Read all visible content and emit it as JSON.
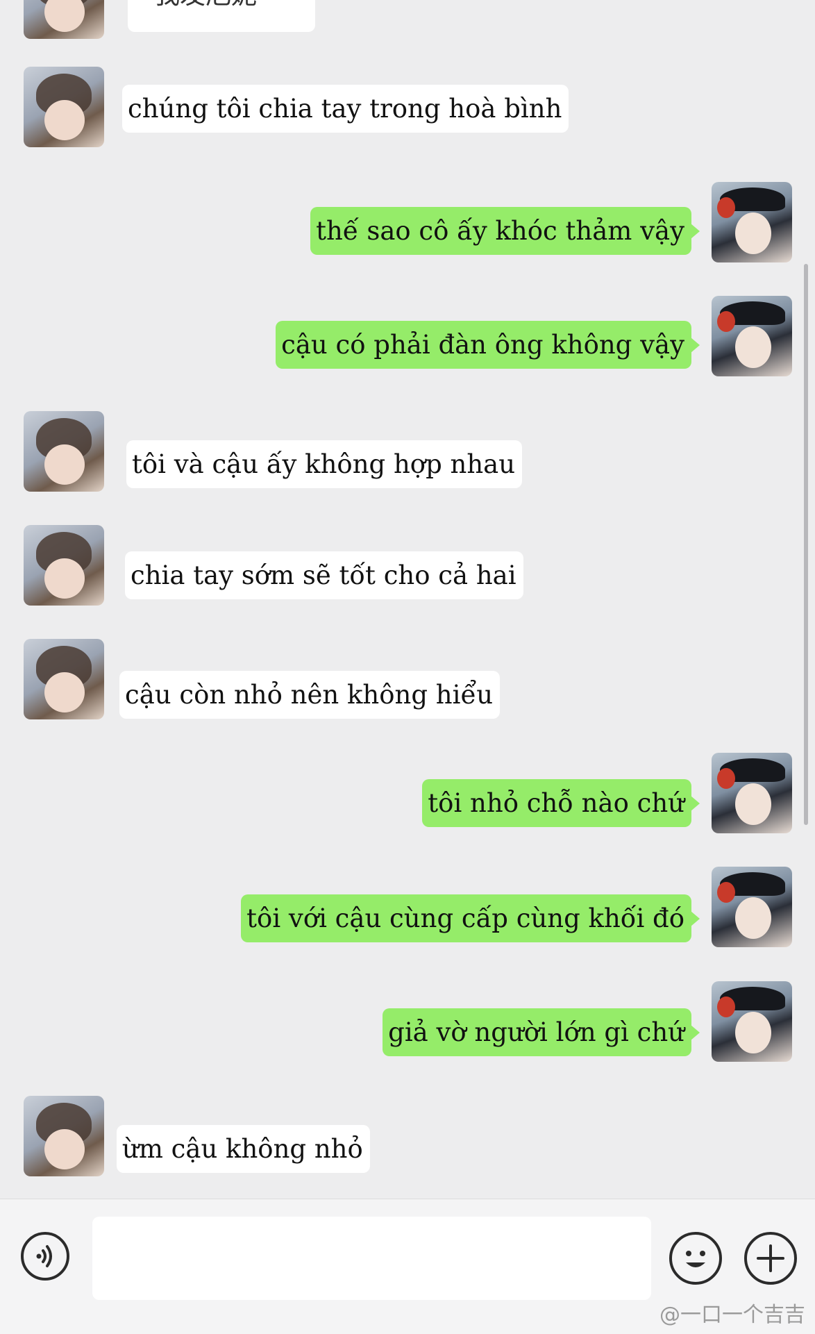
{
  "top_partial": {
    "text": "我发厄妮"
  },
  "messages": [
    {
      "side": "in",
      "text": "chúng tôi chia tay trong hoà bình"
    },
    {
      "side": "out",
      "text": "thế sao cô ấy khóc thảm vậy"
    },
    {
      "side": "out",
      "text": "cậu có phải đàn ông không vậy"
    },
    {
      "side": "in",
      "text": "tôi và cậu ấy không hợp nhau"
    },
    {
      "side": "in",
      "text": "chia tay sớm sẽ tốt cho cả hai"
    },
    {
      "side": "in",
      "text": "cậu còn nhỏ nên không hiểu"
    },
    {
      "side": "out",
      "text": "tôi nhỏ chỗ nào chứ"
    },
    {
      "side": "out",
      "text": "tôi với cậu cùng cấp cùng khối đó"
    },
    {
      "side": "out",
      "text": "giả vờ người lớn gì chứ"
    },
    {
      "side": "in",
      "text": "ừm cậu không nhỏ"
    }
  ],
  "input_bar": {
    "voice_icon": "voice-icon",
    "emoji_icon": "smile-icon",
    "plus_icon": "plus-icon",
    "message_value": ""
  },
  "watermark": "@一口一个吉吉",
  "colors": {
    "outgoing": "#95ec69",
    "incoming": "#ffffff",
    "background": "#ededee"
  }
}
